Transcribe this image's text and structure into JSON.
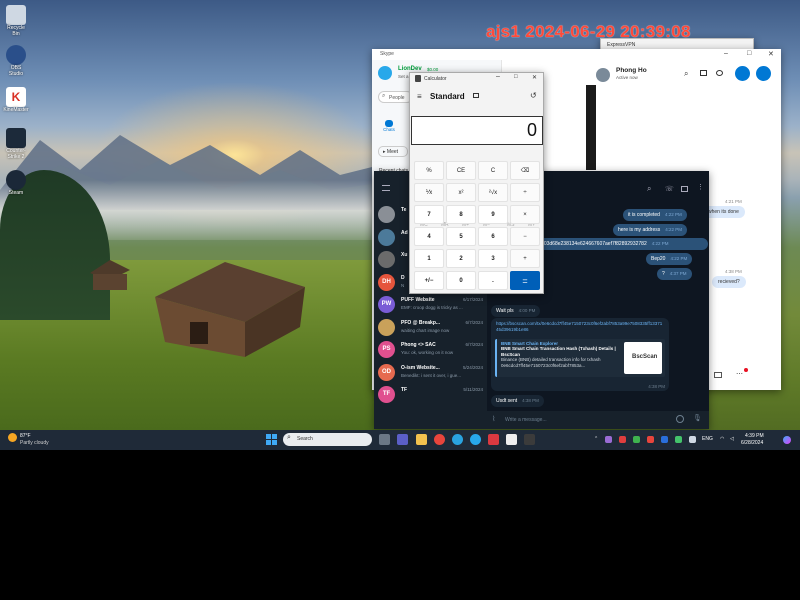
{
  "desktop": {
    "icons": [
      {
        "label": "Recycle Bin",
        "icon": "recycle-bin-icon",
        "color": "#cfd8e3"
      },
      {
        "label": "OBS Studio",
        "icon": "obs-icon",
        "color": "#2a4f8a"
      },
      {
        "label": "KineMaster",
        "icon": "kinemaster-icon",
        "color": "#d93025"
      },
      {
        "label": "Counter-Strike 2",
        "icon": "cs2-icon",
        "color": "#1c2a3a"
      },
      {
        "label": "Steam",
        "icon": "steam-icon",
        "color": "#1b2838"
      }
    ],
    "stamp": "ajs1 2024-06-29 20:39:08"
  },
  "vpn": {
    "title": "ExpressVPN"
  },
  "skype": {
    "title": "Skype",
    "account_name": "LionDev",
    "account_balance": "$0.00",
    "account_status": "Set a status",
    "search_placeholder": "People",
    "nav_chats": "Chats",
    "meet_label": "Meet",
    "recent_chats": "Recent chats",
    "contact_name": "Phong Ho",
    "contact_status": "Active now",
    "messages": [
      {
        "text": "when its done",
        "time": "4:21 PM"
      },
      {
        "text": "recieved?",
        "time": "4:38 PM"
      }
    ]
  },
  "calculator": {
    "title": "Calculator",
    "mode": "Standard",
    "display": "0",
    "memory": [
      "MC",
      "MR",
      "M+",
      "M−",
      "MS",
      "M˅"
    ],
    "keys": [
      "%",
      "CE",
      "C",
      "⌫",
      "⅟x",
      "x²",
      "²√x",
      "÷",
      "7",
      "8",
      "9",
      "×",
      "4",
      "5",
      "6",
      "−",
      "1",
      "2",
      "3",
      "+",
      "+/−",
      "0",
      ".",
      "="
    ]
  },
  "telegram": {
    "chats": [
      {
        "initials": "",
        "name": "Te",
        "preview": "",
        "date": "",
        "color": "#8a8f96"
      },
      {
        "initials": "",
        "name": "Ad",
        "preview": "",
        "date": "",
        "color": "#4c7a9a"
      },
      {
        "initials": "",
        "name": "Xu",
        "preview": "",
        "date": "",
        "color": "#6b6b6b"
      },
      {
        "initials": "DH",
        "name": "D",
        "preview": "N",
        "date": "",
        "color": "#e5553c"
      },
      {
        "initials": "PW",
        "name": "PUFF Website",
        "preview": "EMF: croop dogg is tricky as ...",
        "date": "6/17/2024",
        "color": "#7a5cd6"
      },
      {
        "initials": "",
        "name": "PFO @ Breakp...",
        "preview": "waiting chart image now",
        "date": "6/7/2024",
        "color": "#c9a15a"
      },
      {
        "initials": "PS",
        "name": "Phong <> SAC",
        "preview": "You: ok, working on it now",
        "date": "6/7/2024",
        "color": "#e0508f"
      },
      {
        "initials": "OD",
        "name": "O-ism Website...",
        "preview": "Benedikt: i sent it over, i gue...",
        "date": "5/24/2024",
        "color": "#e66a4f"
      },
      {
        "initials": "TF",
        "name": "TF",
        "preview": "",
        "date": "5/11/2024",
        "color": "#e0508f"
      }
    ],
    "outgoing": [
      {
        "text": "it is completed",
        "time": "4:22 PM"
      },
      {
        "text": "here is my address",
        "time": "4:22 PM"
      },
      {
        "text": "0xe703d68e238134e624667607aef7f82892932782",
        "time": "4:22 PM"
      },
      {
        "text": "Bep20",
        "time": "4:22 PM"
      },
      {
        "text": "?",
        "time": "4:37 PM"
      }
    ],
    "incoming_wait": {
      "text": "Wait pls",
      "time": "4:00 PM"
    },
    "link": "https://bscscan.com/tx/0e6cdcd7ff45e7150723c0f6ef2abf7853a99e7508335ff1337145d39619b1e86",
    "preview_site": "BNB Smart Chain Explorer",
    "preview_title": "BNB Smart Chain Transaction Hash (Txhash) Details | BscScan",
    "preview_desc": "Binance (BNB) detailed transaction info for txhash 0e6cdcd7ff45e7150723c0f6ef2abf7853a...",
    "preview_logo": "BscScan",
    "preview_time": "4:38 PM",
    "usdt": {
      "text": "Usdt sent",
      "time": "4:38 PM"
    },
    "compose_placeholder": "Write a message..."
  },
  "taskbar": {
    "weather_temp": "87°F",
    "weather_desc": "Partly cloudy",
    "search_label": "Search",
    "lang": "ENG",
    "time": "4:39 PM",
    "date": "6/28/2024"
  }
}
